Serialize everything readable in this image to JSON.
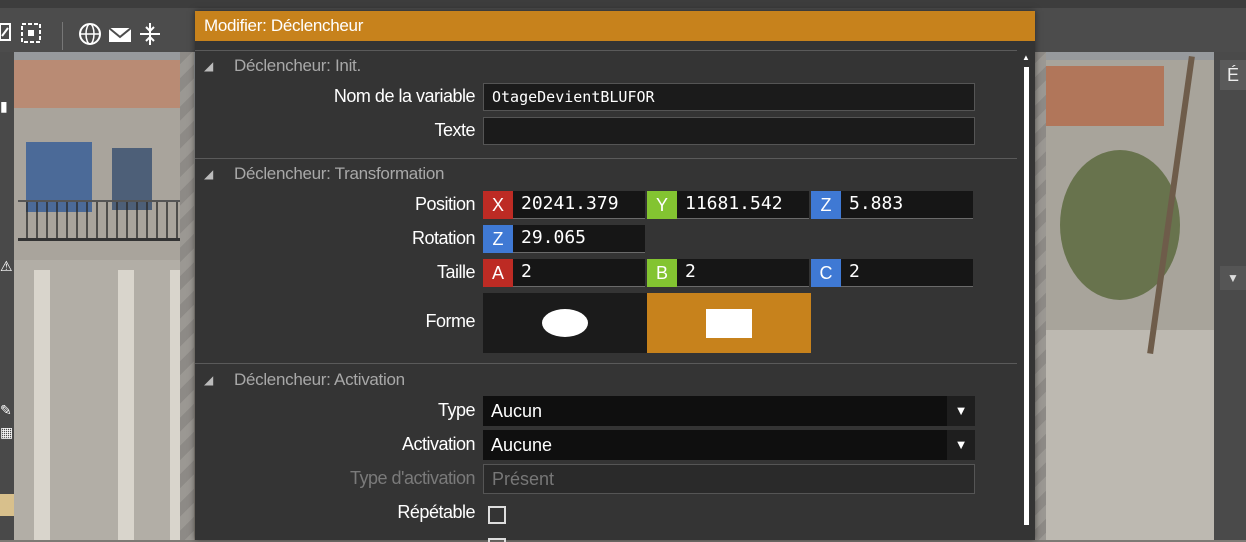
{
  "dialog": {
    "title": "Modifier: Déclencheur"
  },
  "sections": {
    "init": {
      "title": "Déclencheur: Init.",
      "variable_label": "Nom de la variable",
      "variable_value": "OtageDevientBLUFOR",
      "text_label": "Texte",
      "text_value": ""
    },
    "transform": {
      "title": "Déclencheur: Transformation",
      "position_label": "Position",
      "position": {
        "x_tag": "X",
        "x": "20241.379",
        "y_tag": "Y",
        "y": "11681.542",
        "z_tag": "Z",
        "z": "5.883"
      },
      "rotation_label": "Rotation",
      "rotation": {
        "z_tag": "Z",
        "z": "29.065"
      },
      "size_label": "Taille",
      "size": {
        "a_tag": "A",
        "a": "2",
        "b_tag": "B",
        "b": "2",
        "c_tag": "C",
        "c": "2"
      },
      "shape_label": "Forme",
      "shape_options": [
        "ellipse",
        "rectangle"
      ],
      "shape_selected": "rectangle"
    },
    "activation": {
      "title": "Déclencheur: Activation",
      "type_label": "Type",
      "type_value": "Aucun",
      "activation_label": "Activation",
      "activation_value": "Aucune",
      "activation_type_label": "Type d'activation",
      "activation_type_value": "Présent",
      "repeatable_label": "Répétable",
      "repeatable_checked": false
    }
  },
  "colors": {
    "accent": "#c7821c",
    "x_tag": "#bd2b24",
    "y_tag": "#83c431",
    "z_tag": "#3f79d4"
  },
  "toolbar": {
    "icons": [
      "transform-icon",
      "select-area-icon",
      "globe-icon",
      "mail-icon",
      "snap-icon"
    ]
  },
  "right_panel": {
    "tab_letter": "É"
  }
}
